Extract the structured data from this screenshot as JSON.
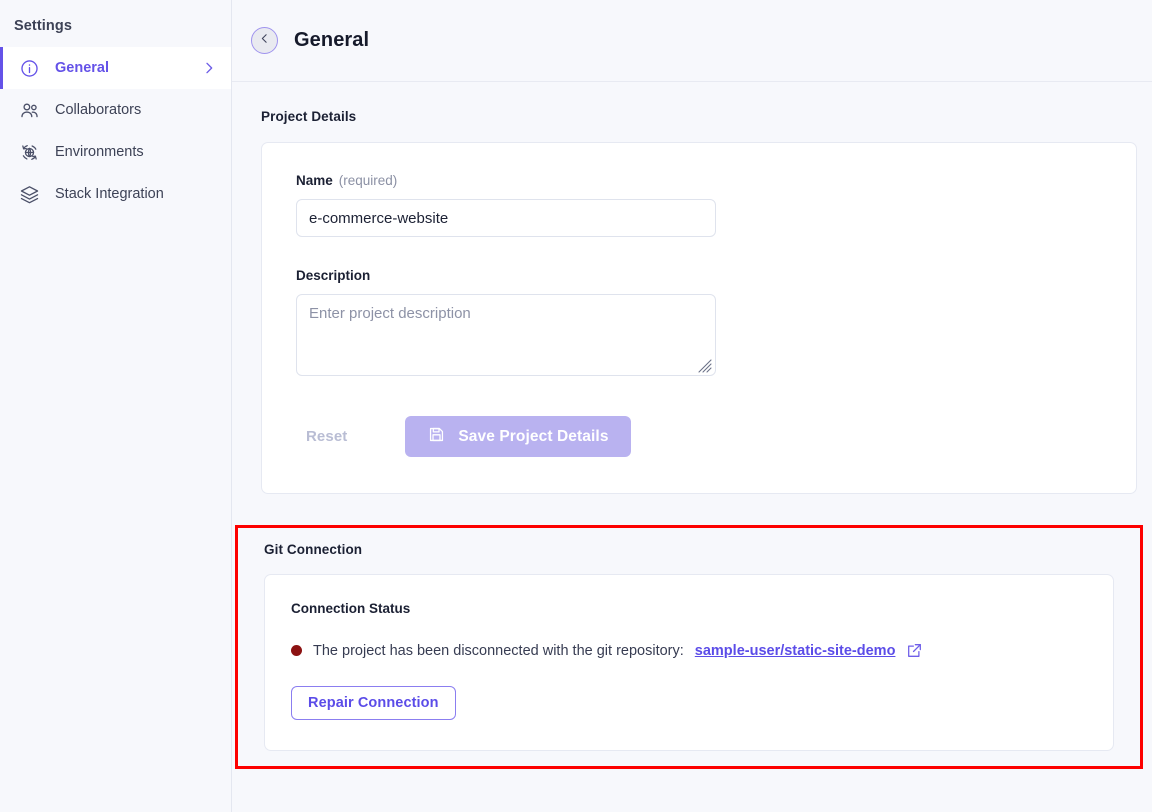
{
  "sidebar": {
    "title": "Settings",
    "items": [
      {
        "label": "General",
        "icon": "info-circle-icon",
        "active": true,
        "chevron": "chevron-right-icon"
      },
      {
        "label": "Collaborators",
        "icon": "users-icon",
        "active": false,
        "chevron": ""
      },
      {
        "label": "Environments",
        "icon": "environment-globe-icon",
        "active": false,
        "chevron": ""
      },
      {
        "label": "Stack Integration",
        "icon": "layers-icon",
        "active": false,
        "chevron": ""
      }
    ]
  },
  "header": {
    "title": "General",
    "back_icon": "chevron-left-icon"
  },
  "project_details": {
    "section_title": "Project Details",
    "name": {
      "label": "Name",
      "required_note": "(required)",
      "value": "e-commerce-website",
      "placeholder": ""
    },
    "description": {
      "label": "Description",
      "value": "",
      "placeholder": "Enter project description"
    },
    "reset_label": "Reset",
    "save_label": "Save Project Details",
    "save_icon": "save-floppy-icon"
  },
  "git_connection": {
    "section_title": "Git Connection",
    "card_title": "Connection Status",
    "status_message": "The project has been disconnected with the git repository:",
    "repository": "sample-user/static-site-demo",
    "external_link_icon": "external-link-icon",
    "status_dot_color": "#8c1212",
    "repair_label": "Repair Connection",
    "highlight_color": "#fd0000"
  },
  "colors": {
    "accent": "#6452e8",
    "page_background": "#f7f8fc",
    "card_background": "#ffffff",
    "border": "#e6e9f2"
  }
}
